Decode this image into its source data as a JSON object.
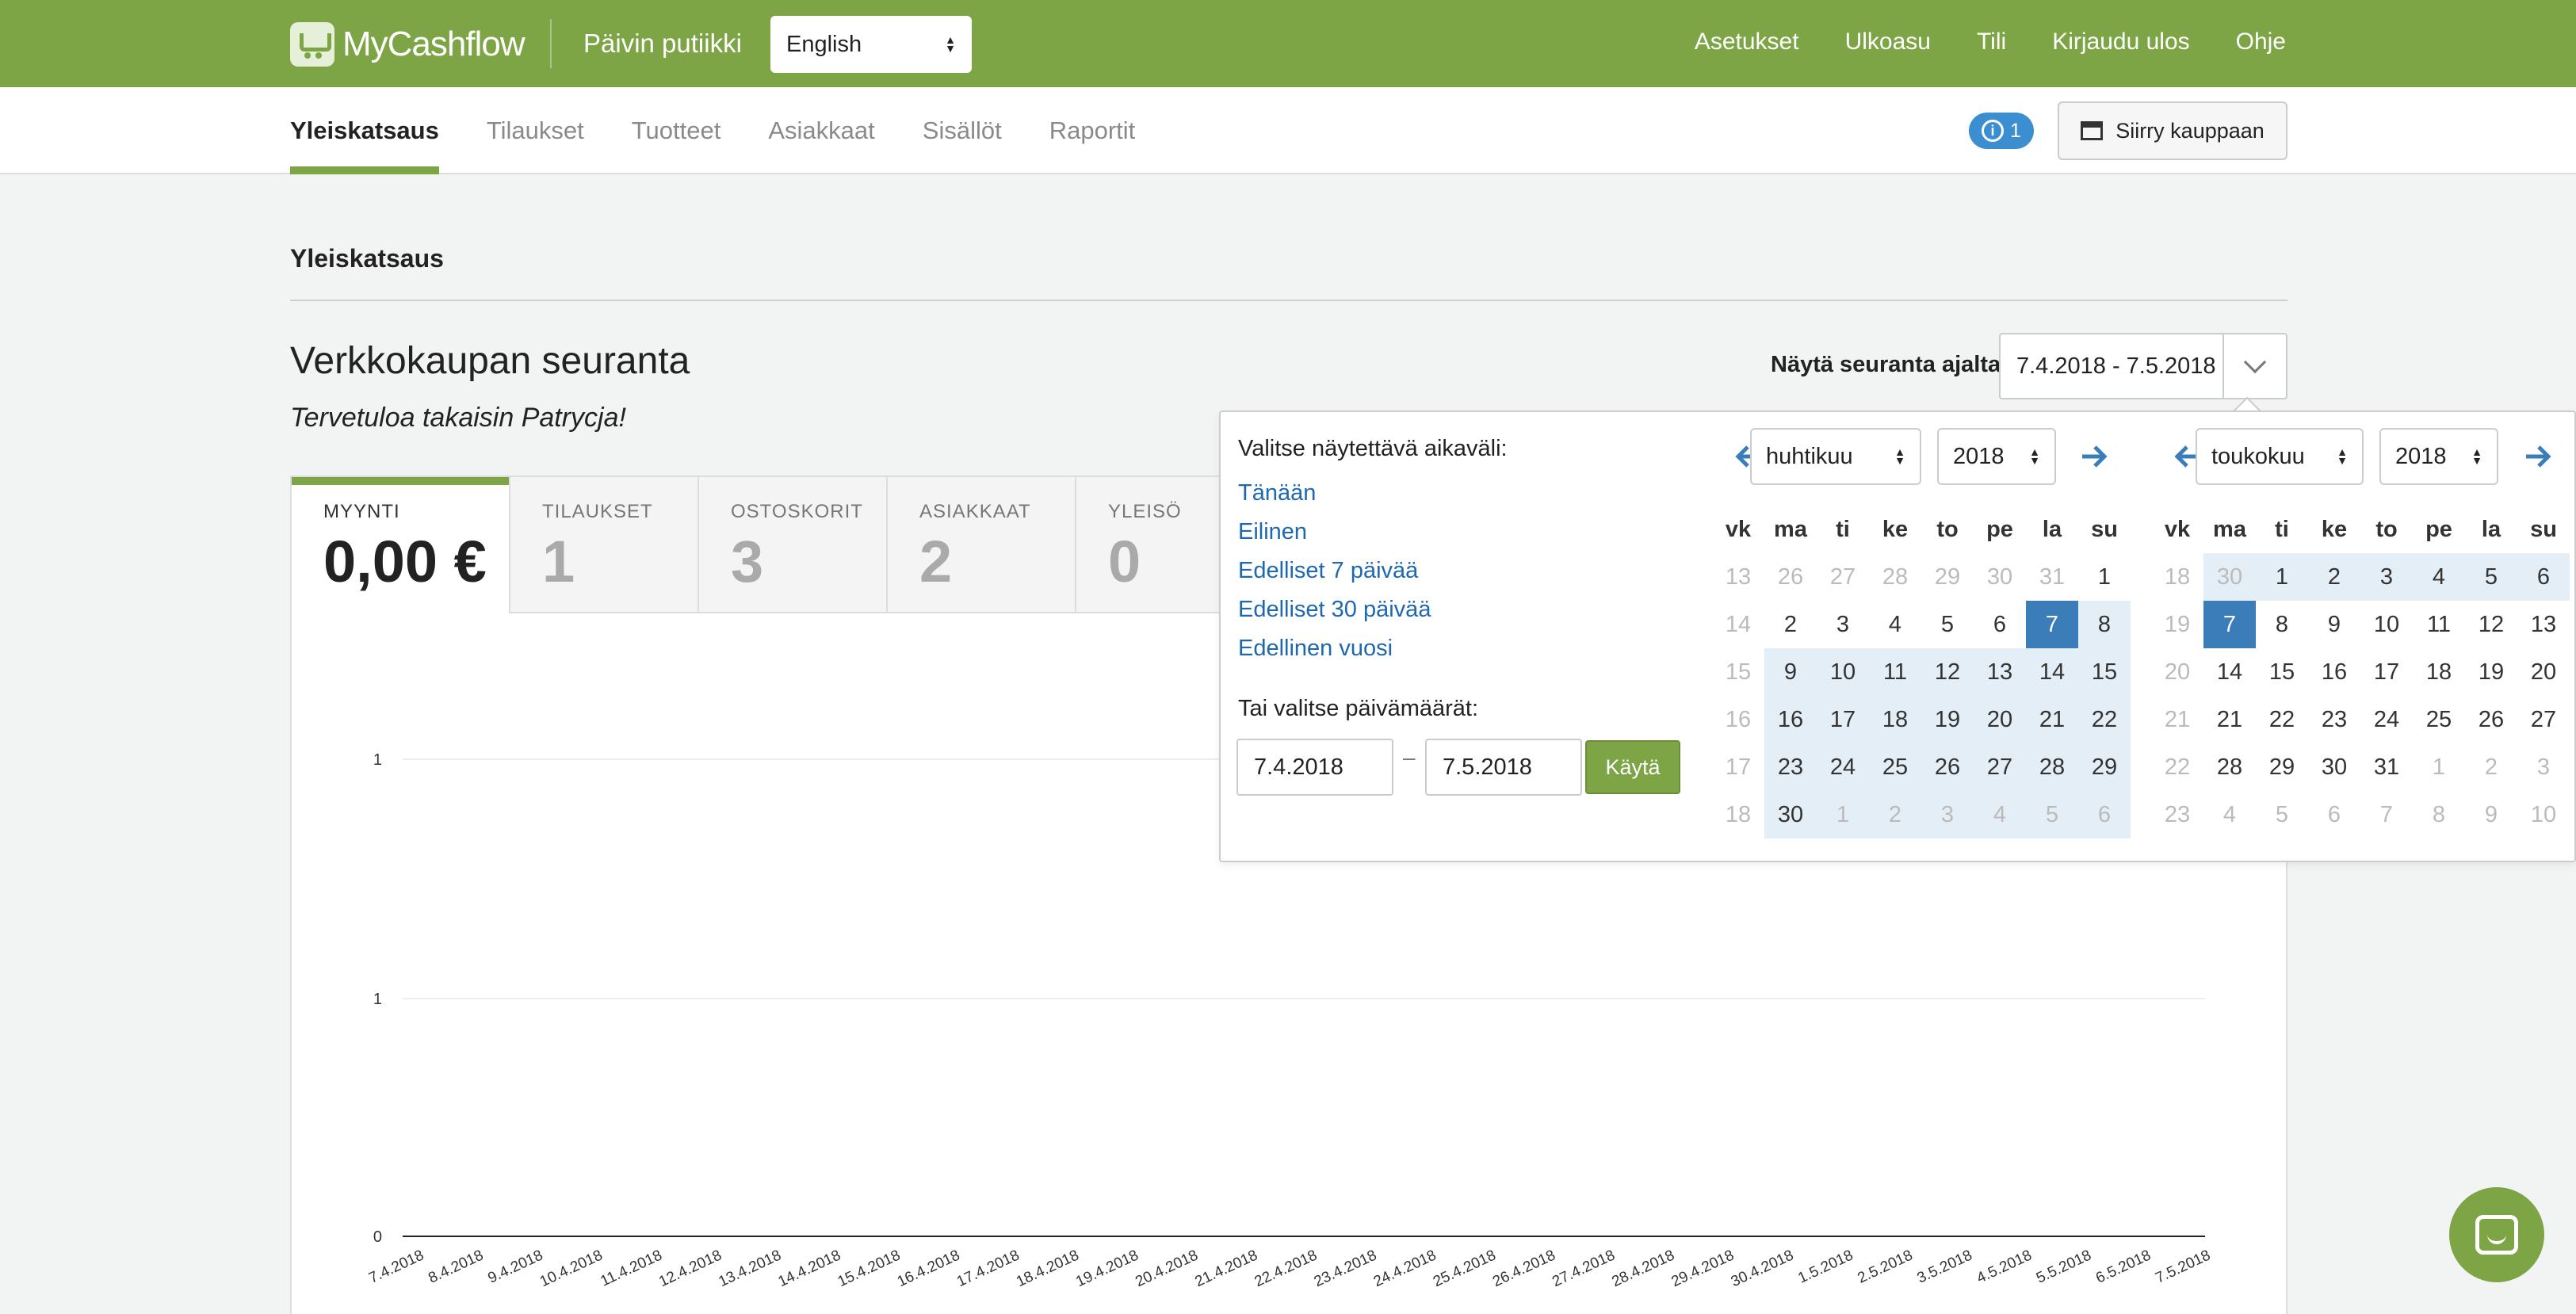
{
  "brand": {
    "name": "MyCashflow",
    "shop_name": "Päivin putiikki"
  },
  "language": {
    "selected": "English"
  },
  "top_nav": [
    "Asetukset",
    "Ulkoasu",
    "Tili",
    "Kirjaudu ulos",
    "Ohje"
  ],
  "main_tabs": [
    {
      "label": "Yleiskatsaus",
      "active": true
    },
    {
      "label": "Tilaukset"
    },
    {
      "label": "Tuotteet"
    },
    {
      "label": "Asiakkaat"
    },
    {
      "label": "Sisällöt"
    },
    {
      "label": "Raportit"
    }
  ],
  "notifications": {
    "count": "1"
  },
  "store_button": "Siirry kauppaan",
  "breadcrumb": "Yleiskatsaus",
  "page_title": "Verkkokaupan seuranta",
  "welcome": "Tervetuloa takaisin Patrycja!",
  "range": {
    "label": "Näytä seuranta ajalta",
    "value": "7.4.2018 - 7.5.2018"
  },
  "stats": [
    {
      "label": "MYYNTI",
      "value": "0,00 €",
      "active": true
    },
    {
      "label": "TILAUKSET",
      "value": "1"
    },
    {
      "label": "OSTOSKORIT",
      "value": "3"
    },
    {
      "label": "ASIAKKAAT",
      "value": "2"
    },
    {
      "label": "YLEISÖ",
      "value": "0"
    }
  ],
  "picker": {
    "title": "Valitse näytettävä aikaväli:",
    "presets": [
      "Tänään",
      "Eilinen",
      "Edelliset 7 päivää",
      "Edelliset 30 päivää",
      "Edellinen vuosi"
    ],
    "or_label": "Tai valitse päivämäärät:",
    "from": "7.4.2018",
    "to": "7.5.2018",
    "separator": "–",
    "apply": "Käytä",
    "weekday_headers": [
      "vk",
      "ma",
      "ti",
      "ke",
      "to",
      "pe",
      "la",
      "su"
    ],
    "calendars": [
      {
        "month": "huhtikuu",
        "year": "2018",
        "weeks": [
          {
            "wk": "13",
            "days": [
              "26",
              "27",
              "28",
              "29",
              "30",
              "31",
              "1"
            ]
          },
          {
            "wk": "14",
            "days": [
              "2",
              "3",
              "4",
              "5",
              "6",
              "7",
              "8"
            ]
          },
          {
            "wk": "15",
            "days": [
              "9",
              "10",
              "11",
              "12",
              "13",
              "14",
              "15"
            ]
          },
          {
            "wk": "16",
            "days": [
              "16",
              "17",
              "18",
              "19",
              "20",
              "21",
              "22"
            ]
          },
          {
            "wk": "17",
            "days": [
              "23",
              "24",
              "25",
              "26",
              "27",
              "28",
              "29"
            ]
          },
          {
            "wk": "18",
            "days": [
              "30",
              "1",
              "2",
              "3",
              "4",
              "5",
              "6"
            ]
          }
        ]
      },
      {
        "month": "toukokuu",
        "year": "2018",
        "weeks": [
          {
            "wk": "18",
            "days": [
              "30",
              "1",
              "2",
              "3",
              "4",
              "5",
              "6"
            ]
          },
          {
            "wk": "19",
            "days": [
              "7",
              "8",
              "9",
              "10",
              "11",
              "12",
              "13"
            ]
          },
          {
            "wk": "20",
            "days": [
              "14",
              "15",
              "16",
              "17",
              "18",
              "19",
              "20"
            ]
          },
          {
            "wk": "21",
            "days": [
              "21",
              "22",
              "23",
              "24",
              "25",
              "26",
              "27"
            ]
          },
          {
            "wk": "22",
            "days": [
              "28",
              "29",
              "30",
              "31",
              "1",
              "2",
              "3"
            ]
          },
          {
            "wk": "23",
            "days": [
              "4",
              "5",
              "6",
              "7",
              "8",
              "9",
              "10"
            ]
          }
        ]
      }
    ]
  },
  "chart_data": {
    "type": "line",
    "y_ticks": [
      "1",
      "1",
      "0"
    ],
    "ylim": [
      0,
      1
    ],
    "x": [
      "7.4.2018",
      "8.4.2018",
      "9.4.2018",
      "10.4.2018",
      "11.4.2018",
      "12.4.2018",
      "13.4.2018",
      "14.4.2018",
      "15.4.2018",
      "16.4.2018",
      "17.4.2018",
      "18.4.2018",
      "19.4.2018",
      "20.4.2018",
      "21.4.2018",
      "22.4.2018",
      "23.4.2018",
      "24.4.2018",
      "25.4.2018",
      "26.4.2018",
      "27.4.2018",
      "28.4.2018",
      "29.4.2018",
      "30.4.2018",
      "1.5.2018",
      "2.5.2018",
      "3.5.2018",
      "4.5.2018",
      "5.5.2018",
      "6.5.2018",
      "7.5.2018"
    ],
    "series": [
      {
        "values": [
          0,
          0,
          0,
          0,
          0,
          0,
          0,
          0,
          0,
          0,
          0,
          0,
          0,
          0,
          0,
          0,
          0,
          0,
          0,
          0,
          0,
          0,
          0,
          0,
          0,
          0,
          0,
          0,
          0,
          0,
          0
        ]
      }
    ],
    "grid": true
  }
}
